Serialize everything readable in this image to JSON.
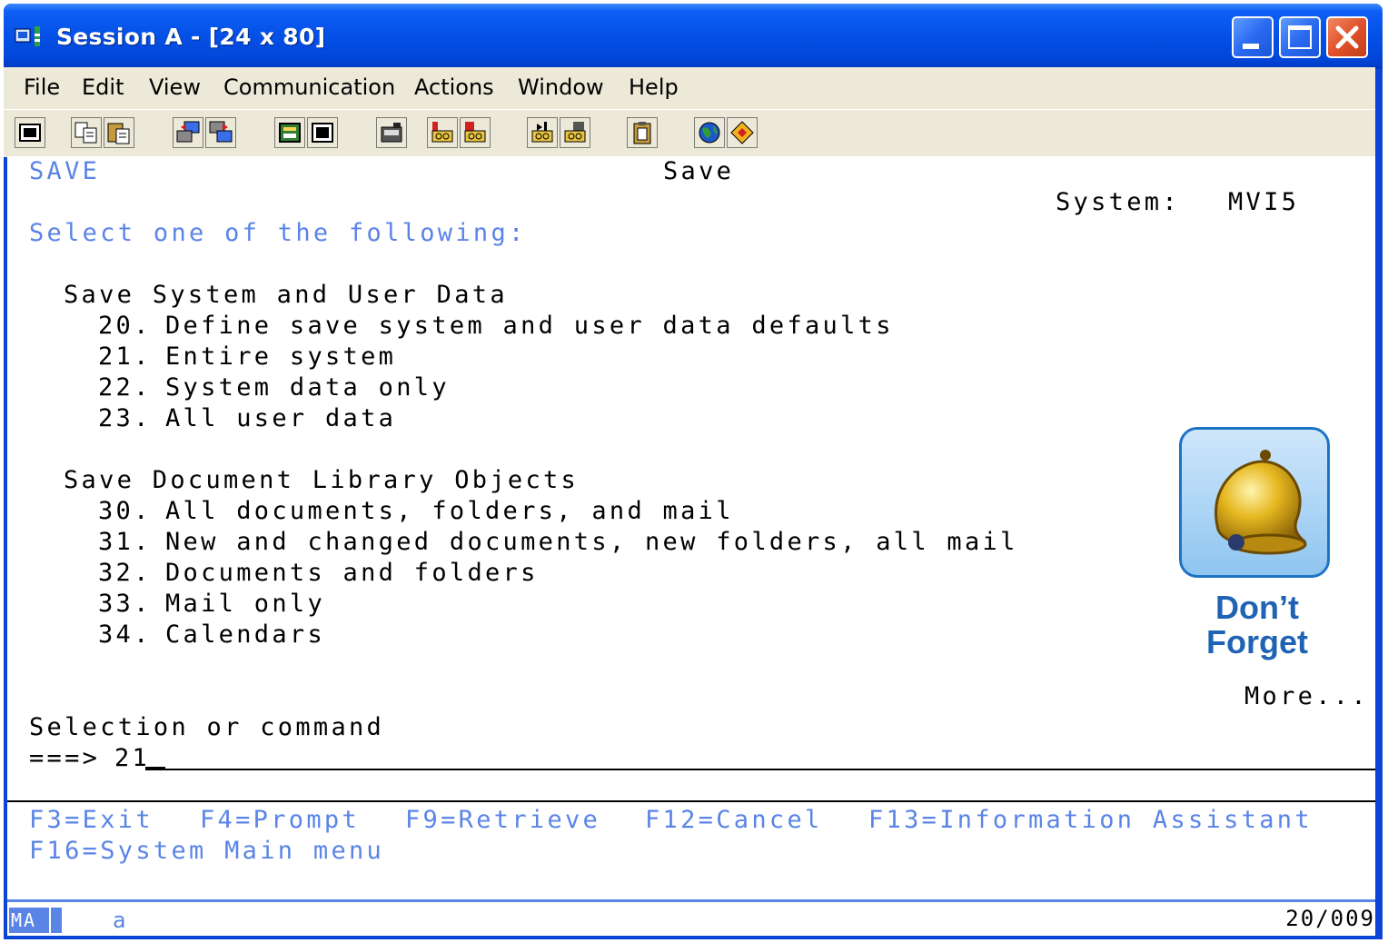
{
  "window": {
    "title": "Session A - [24 x 80]"
  },
  "menu": [
    "File",
    "Edit",
    "View",
    "Communication",
    "Actions",
    "Window",
    "Help"
  ],
  "toolbar_icons": [
    "print-screen-icon",
    "copy-icon",
    "paste-icon",
    "send-file-icon",
    "receive-file-icon",
    "display-keypad-icon",
    "display-keypad-2-icon",
    "record-macro-icon",
    "play-macro-icon",
    "stop-macro-icon",
    "macro-run-icon",
    "macro-edit-icon",
    "clipboard-icon",
    "web-icon",
    "support-icon"
  ],
  "screen": {
    "menu_id": "SAVE",
    "title": "Save",
    "system_label": "System:",
    "system_value": "MVI5",
    "instruction": "Select one of the following:",
    "groups": [
      {
        "heading": "Save System and User Data",
        "options": [
          {
            "num": "20.",
            "text": "Define save system and user data defaults"
          },
          {
            "num": "21.",
            "text": "Entire system"
          },
          {
            "num": "22.",
            "text": "System data only"
          },
          {
            "num": "23.",
            "text": "All user data"
          }
        ]
      },
      {
        "heading": "Save Document Library Objects",
        "options": [
          {
            "num": "30.",
            "text": "All documents, folders, and mail"
          },
          {
            "num": "31.",
            "text": "New and changed documents, new folders, all mail"
          },
          {
            "num": "32.",
            "text": "Documents and folders"
          },
          {
            "num": "33.",
            "text": "Mail only"
          },
          {
            "num": "34.",
            "text": "Calendars"
          }
        ]
      }
    ],
    "more": "More...",
    "selection_label": "Selection or command",
    "prompt": "===>",
    "command_value": "21",
    "fkeys_line1": [
      "F3=Exit",
      "F4=Prompt",
      "F9=Retrieve",
      "F12=Cancel",
      "F13=Information Assistant"
    ],
    "fkeys_line2": [
      "F16=System Main menu"
    ]
  },
  "callout": {
    "line1": "Don’t",
    "line2": "Forget",
    "icon": "bell-icon"
  },
  "status": {
    "mode": "MA",
    "indicator": "a",
    "cursor_position": "20/009"
  },
  "colors": {
    "titlebar": "#0550e6",
    "field_blue": "#5a84e6",
    "menubar": "#ece9d8"
  }
}
